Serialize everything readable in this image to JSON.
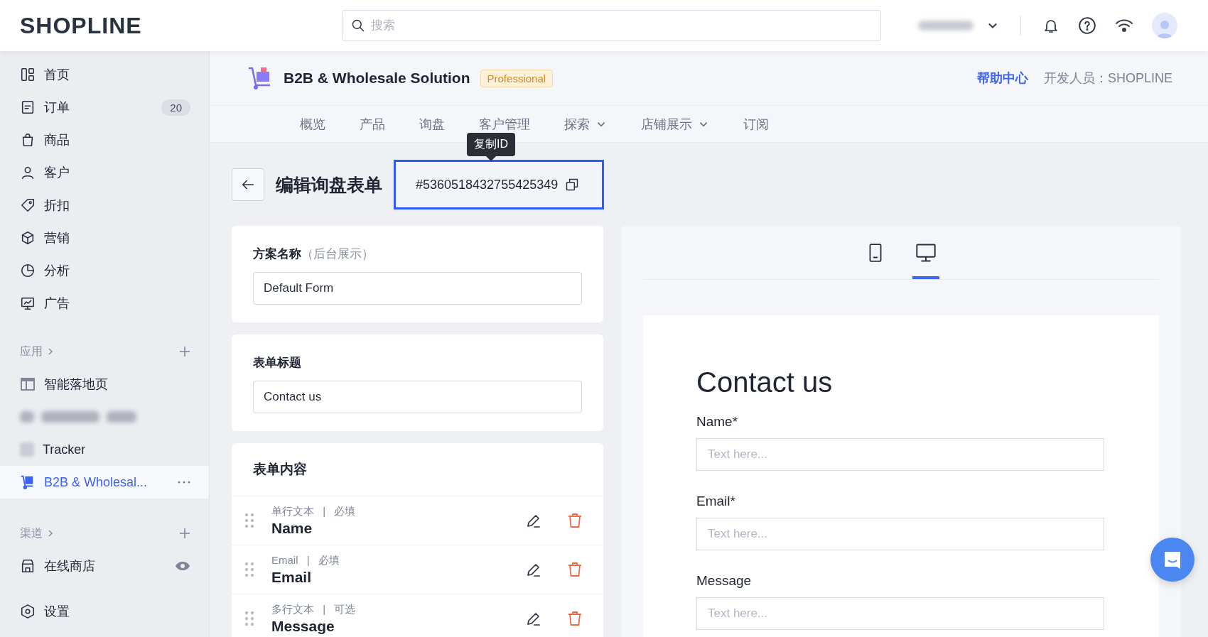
{
  "header": {
    "logo": "SHOPLINE",
    "search": {
      "placeholder": "搜索"
    }
  },
  "sidebar": {
    "items": [
      {
        "label": "首页",
        "selected": false
      },
      {
        "label": "订单",
        "badge": "20",
        "selected": false
      },
      {
        "label": "商品",
        "selected": false
      },
      {
        "label": "客户",
        "selected": false
      },
      {
        "label": "折扣",
        "selected": false
      },
      {
        "label": "营销",
        "selected": false
      },
      {
        "label": "分析",
        "selected": false
      },
      {
        "label": "广告",
        "selected": false
      }
    ],
    "apps": {
      "title": "应用",
      "items": [
        {
          "kind": "app",
          "label": "智能落地页",
          "selected": false
        },
        {
          "kind": "redacted",
          "selected": false
        },
        {
          "kind": "app",
          "label": "Tracker",
          "selected": false
        },
        {
          "kind": "app",
          "label": "B2B & Wholesal...",
          "selected": true
        }
      ]
    },
    "channels": {
      "title": "渠道",
      "items": [
        {
          "label": "在线商店",
          "visible": true
        }
      ]
    },
    "settings": "设置"
  },
  "app": {
    "name": "B2B & Wholesale Solution",
    "plan": "Professional",
    "help": "帮助中心",
    "developer": "开发人员：SHOPLINE",
    "tabs": [
      {
        "label": "概览",
        "selected": false,
        "dropdown": false
      },
      {
        "label": "产品",
        "selected": false,
        "dropdown": false
      },
      {
        "label": "询盘",
        "selected": false,
        "dropdown": false
      },
      {
        "label": "客户管理",
        "selected": false,
        "dropdown": false
      },
      {
        "label": "探索",
        "selected": false,
        "dropdown": true
      },
      {
        "label": "店铺展示",
        "selected": false,
        "dropdown": true
      },
      {
        "label": "订阅",
        "selected": false,
        "dropdown": false
      }
    ],
    "tooltip": "复制ID"
  },
  "page": {
    "title": "编辑询盘表单",
    "id": "#5360518432755425349",
    "highlighted": true
  },
  "editor": {
    "scheme": {
      "label": "方案名称",
      "hint": "（后台展示）",
      "value": "Default Form"
    },
    "form_title": {
      "label": "表单标题",
      "value": "Contact us"
    },
    "content": {
      "title": "表单内容",
      "fields": [
        {
          "meta": "单行文本 | 必填",
          "name": "Name"
        },
        {
          "meta": "Email | 必填",
          "name": "Email"
        },
        {
          "meta": "多行文本 | 可选",
          "name": "Message"
        }
      ]
    }
  },
  "preview": {
    "devices": [
      {
        "kind": "mobile",
        "selected": false
      },
      {
        "kind": "desktop",
        "selected": true
      }
    ],
    "title": "Contact us",
    "fields": [
      {
        "label": "Name*",
        "placeholder": "Text here..."
      },
      {
        "label": "Email*",
        "placeholder": "Text here..."
      },
      {
        "label": "Message",
        "placeholder": "Text here..."
      }
    ]
  }
}
